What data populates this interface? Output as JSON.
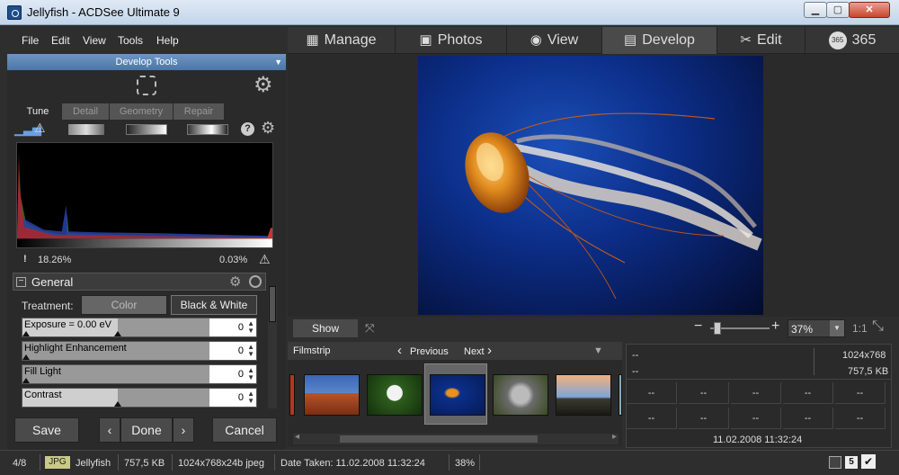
{
  "window": {
    "title": "Jellyfish - ACDSee Ultimate 9"
  },
  "menu": {
    "items": [
      "File",
      "Edit",
      "View",
      "Tools",
      "Help"
    ]
  },
  "modes": [
    {
      "label": "Manage",
      "icon": "grid-icon"
    },
    {
      "label": "Photos",
      "icon": "photos-icon"
    },
    {
      "label": "View",
      "icon": "eye-icon"
    },
    {
      "label": "Develop",
      "icon": "develop-icon"
    },
    {
      "label": "Edit",
      "icon": "edit-icon"
    },
    {
      "label": "365",
      "icon": "365-icon"
    }
  ],
  "develop": {
    "header": "Develop Tools",
    "tabs": [
      "Tune",
      "Detail",
      "Geometry",
      "Repair"
    ],
    "active_tab": "Tune",
    "hist_stats": {
      "left": "18.26%",
      "right": "0.03%"
    },
    "general": {
      "title": "General",
      "treatment_label": "Treatment:",
      "color_btn": "Color",
      "bw_btn": "Black & White",
      "sliders": [
        {
          "label": "Exposure = 0.00 eV",
          "value": "0"
        },
        {
          "label": "Highlight Enhancement",
          "value": "0"
        },
        {
          "label": "Fill Light",
          "value": "0"
        },
        {
          "label": "Contrast",
          "value": "0"
        }
      ]
    },
    "buttons": {
      "save": "Save",
      "done": "Done",
      "cancel": "Cancel"
    }
  },
  "viewbar": {
    "show_original": "Show Original",
    "zoom": "37%",
    "ratio": "1:1"
  },
  "filmstrip": {
    "title": "Filmstrip",
    "previous": "Previous",
    "next": "Next"
  },
  "info": {
    "dash": "--",
    "dimensions": "1024x768",
    "filesize": "757,5 KB",
    "date": "11.02.2008 11:32:24"
  },
  "status": {
    "index": "4/8",
    "type": "JPG",
    "name": "Jellyfish",
    "size": "757,5 KB",
    "format": "1024x768x24b jpeg",
    "date_taken": "Date Taken: 11.02.2008 11:32:24",
    "zoom": "38%",
    "badge": "5"
  }
}
